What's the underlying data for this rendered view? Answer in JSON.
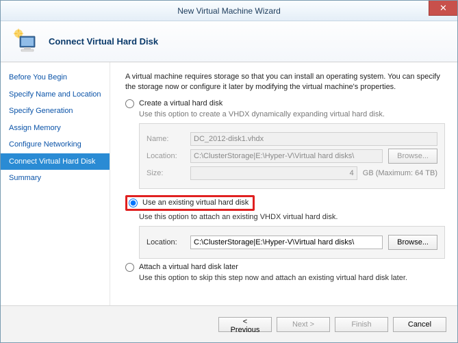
{
  "window": {
    "title": "New Virtual Machine Wizard",
    "close": "✕"
  },
  "header": {
    "title": "Connect Virtual Hard Disk"
  },
  "sidebar": {
    "items": [
      {
        "label": "Before You Begin"
      },
      {
        "label": "Specify Name and Location"
      },
      {
        "label": "Specify Generation"
      },
      {
        "label": "Assign Memory"
      },
      {
        "label": "Configure Networking"
      },
      {
        "label": "Connect Virtual Hard Disk"
      },
      {
        "label": "Summary"
      }
    ],
    "active_index": 5
  },
  "main": {
    "intro": "A virtual machine requires storage so that you can install an operating system. You can specify the storage now or configure it later by modifying the virtual machine's properties.",
    "option1": {
      "label": "Create a virtual hard disk",
      "desc": "Use this option to create a VHDX dynamically expanding virtual hard disk.",
      "name_label": "Name:",
      "name_value": "DC_2012-disk1.vhdx",
      "location_label": "Location:",
      "location_value": "C:\\ClusterStorage|E:\\Hyper-V\\Virtual hard disks\\",
      "browse": "Browse...",
      "size_label": "Size:",
      "size_value": "4",
      "size_unit": "GB (Maximum: 64 TB)"
    },
    "option2": {
      "label": "Use an existing virtual hard disk",
      "desc": "Use this option to attach an existing VHDX virtual hard disk.",
      "location_label": "Location:",
      "location_value": "C:\\ClusterStorage|E:\\Hyper-V\\Virtual hard disks\\",
      "browse": "Browse..."
    },
    "option3": {
      "label": "Attach a virtual hard disk later",
      "desc": "Use this option to skip this step now and attach an existing virtual hard disk later."
    },
    "selected_option": 2
  },
  "footer": {
    "previous": "< Previous",
    "next": "Next >",
    "finish": "Finish",
    "cancel": "Cancel"
  }
}
